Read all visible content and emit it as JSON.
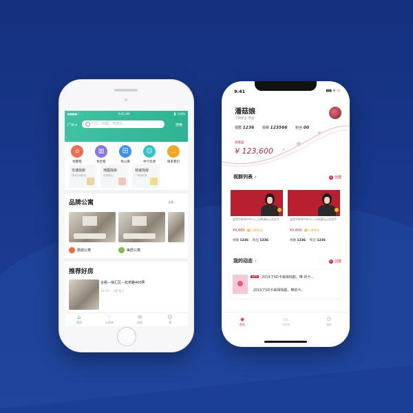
{
  "colors": {
    "background": "#16317f",
    "accent_green": "#2fb393",
    "accent_red": "#c8203a"
  },
  "phone1": {
    "status": {
      "carrier": "●●●●○ ...",
      "time": "9:41 AM",
      "battery": "▌ 100%"
    },
    "city": "广州 ▾",
    "search_placeholder": "小区、商圈、地铁站",
    "search_button": "搜索",
    "quick_icons": [
      {
        "label": "找整租",
        "color": "#f26a4f",
        "glyph": "⌂"
      },
      {
        "label": "找合租",
        "color": "#8a74e6",
        "glyph": "▥"
      },
      {
        "label": "找公寓",
        "color": "#3b8ff0",
        "glyph": "田"
      },
      {
        "label": "中介房源",
        "color": "#35c2c9",
        "glyph": "☺"
      },
      {
        "label": "联系我们",
        "color": "#f4a623",
        "glyph": "…"
      }
    ],
    "feature_cards": [
      {
        "title": "交通找房",
        "subtitle": "找附近地铁站"
      },
      {
        "title": "地图找房",
        "subtitle": "查看周边"
      },
      {
        "title": "快速找房",
        "subtitle": "一键找房源"
      }
    ],
    "brand_section": {
      "title": "品牌公寓",
      "more": "全部 ›"
    },
    "brands": [
      {
        "name": "蘑菇公寓",
        "color": "#f06a3a"
      },
      {
        "name": "美居公寓",
        "color": "#78c142"
      }
    ],
    "recommend": {
      "title": "推荐好房",
      "listing": "合租—徐汇区—虹桥路400弄",
      "detail": "14.5m²…3室·独卫"
    },
    "tabbar": [
      {
        "label": "首页",
        "glyph": "⌂"
      },
      {
        "label": "心愿单",
        "glyph": "♡"
      },
      {
        "label": "消息",
        "glyph": "✉"
      },
      {
        "label": "我",
        "glyph": "☺"
      }
    ]
  },
  "phone2": {
    "time": "9:41",
    "signal": "▮▮▮ ≋ ▭",
    "name": "潘菇娘",
    "subtitle": "万物致远·恭喜",
    "stats": [
      {
        "label": "视群",
        "value": "1236"
      },
      {
        "label": "视频",
        "value": "123566"
      },
      {
        "label": "粉丝",
        "value": "00"
      }
    ],
    "earnings_label": "总收益",
    "earnings": "¥ 123,600",
    "video_section": {
      "title": "视群列表",
      "arrow": "›",
      "create": "创建"
    },
    "videos": [
      {
        "desc": "爱德华斯琴中的卡上乐刷潘玩山东快手",
        "price": "¥3,600",
        "gold": "🪙1,4800金",
        "views_label": "视群",
        "views": "1236",
        "fans_label": "粉丝",
        "fans": "1236"
      },
      {
        "desc": "爱德华斯琴中的卡上乐刷潘玩山东快手",
        "price": "¥3,600",
        "gold": "🪙1,4800金",
        "views_label": "视群",
        "views": "1236",
        "fans_label": "粉丝",
        "fans": "1236"
      }
    ],
    "dynamic_section": {
      "title": "我的动态",
      "arrow": "›",
      "create": "创建"
    },
    "dynamic": {
      "tag": "NEW",
      "line1": "2019了SD卡来得快颜。带 的卡…",
      "line2": "·2019了SD卡来得快颜。带的卡。"
    },
    "tabbar": [
      {
        "label": "首页",
        "glyph": "◉"
      },
      {
        "label": "工作台",
        "glyph": "▭"
      },
      {
        "label": "我的",
        "glyph": "☺"
      }
    ]
  }
}
